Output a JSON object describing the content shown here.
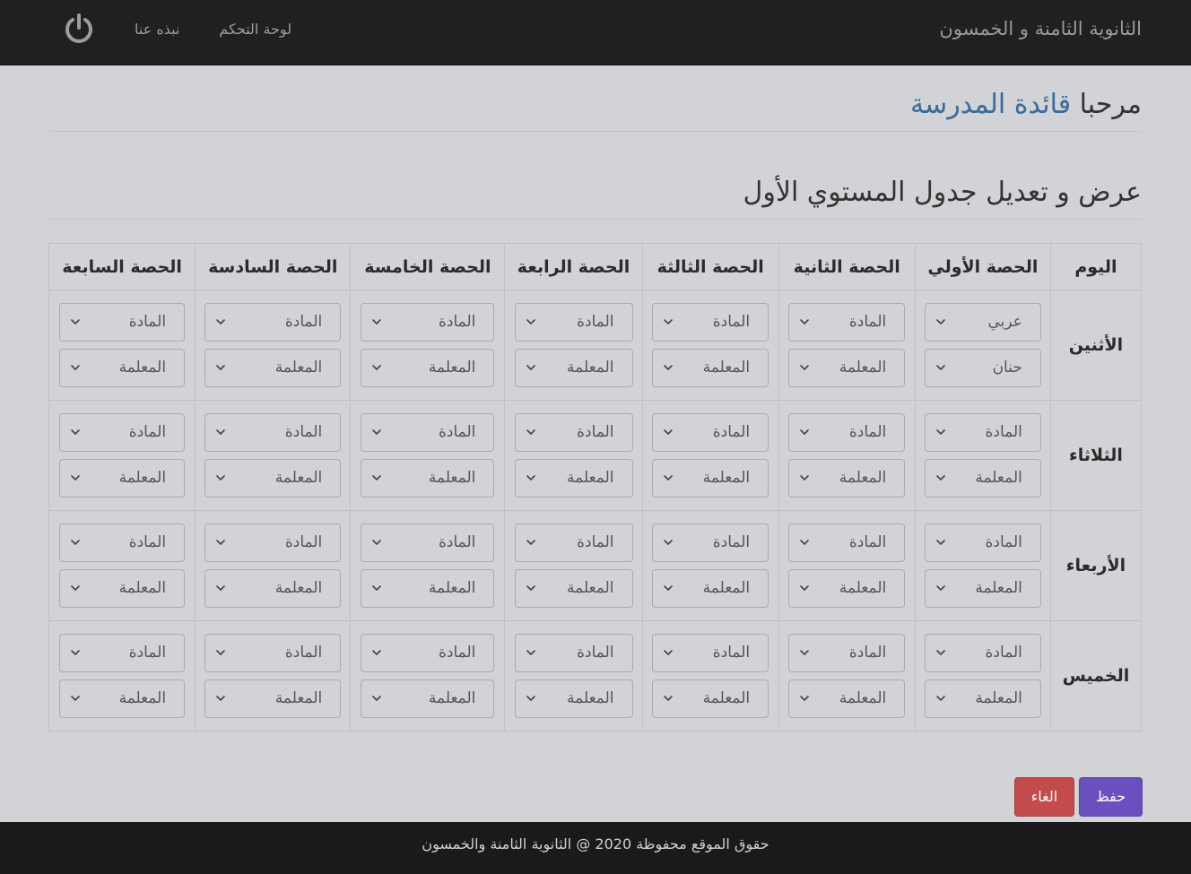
{
  "navbar": {
    "brand": "الثانوية الثامنة و الخمسون",
    "links": [
      "لوحة التحكم",
      "نبذه عنا"
    ],
    "power_icon": "power-icon"
  },
  "welcome": {
    "greeting": "مرحبا",
    "name": "قائدة المدرسة"
  },
  "page_heading": "عرض و تعديل جدول المستوي الأول",
  "schedule": {
    "headers": [
      "اليوم",
      "الحصة الأولي",
      "الحصة الثانية",
      "الحصة الثالثة",
      "الحصة الرابعة",
      "الحصة الخامسة",
      "الحصة السادسة",
      "الحصة السابعة"
    ],
    "days": [
      {
        "day": "الأثنين",
        "periods": [
          {
            "subject": "عربي",
            "teacher": "حنان"
          },
          {
            "subject": "المادة",
            "teacher": "المعلمة"
          },
          {
            "subject": "المادة",
            "teacher": "المعلمة"
          },
          {
            "subject": "المادة",
            "teacher": "المعلمة"
          },
          {
            "subject": "المادة",
            "teacher": "المعلمة"
          },
          {
            "subject": "المادة",
            "teacher": "المعلمة"
          },
          {
            "subject": "المادة",
            "teacher": "المعلمة"
          }
        ]
      },
      {
        "day": "الثلاثاء",
        "periods": [
          {
            "subject": "المادة",
            "teacher": "المعلمة"
          },
          {
            "subject": "المادة",
            "teacher": "المعلمة"
          },
          {
            "subject": "المادة",
            "teacher": "المعلمة"
          },
          {
            "subject": "المادة",
            "teacher": "المعلمة"
          },
          {
            "subject": "المادة",
            "teacher": "المعلمة"
          },
          {
            "subject": "المادة",
            "teacher": "المعلمة"
          },
          {
            "subject": "المادة",
            "teacher": "المعلمة"
          }
        ]
      },
      {
        "day": "الأربعاء",
        "periods": [
          {
            "subject": "المادة",
            "teacher": "المعلمة"
          },
          {
            "subject": "المادة",
            "teacher": "المعلمة"
          },
          {
            "subject": "المادة",
            "teacher": "المعلمة"
          },
          {
            "subject": "المادة",
            "teacher": "المعلمة"
          },
          {
            "subject": "المادة",
            "teacher": "المعلمة"
          },
          {
            "subject": "المادة",
            "teacher": "المعلمة"
          },
          {
            "subject": "المادة",
            "teacher": "المعلمة"
          }
        ]
      },
      {
        "day": "الخميس",
        "periods": [
          {
            "subject": "المادة",
            "teacher": "المعلمة"
          },
          {
            "subject": "المادة",
            "teacher": "المعلمة"
          },
          {
            "subject": "المادة",
            "teacher": "المعلمة"
          },
          {
            "subject": "المادة",
            "teacher": "المعلمة"
          },
          {
            "subject": "المادة",
            "teacher": "المعلمة"
          },
          {
            "subject": "المادة",
            "teacher": "المعلمة"
          },
          {
            "subject": "المادة",
            "teacher": "المعلمة"
          }
        ]
      }
    ]
  },
  "actions": {
    "save_label": "حفظ",
    "cancel_label": "الغاء"
  },
  "footer": {
    "text": "حقوق الموقع محفوظة 2020 @ الثانوية الثامنة والخمسون"
  },
  "colors": {
    "navbar_bg": "#1f2022",
    "page_bg": "#d1d3d6",
    "accent_name": "#3a6b9c",
    "save_button": "#6a4fbf",
    "cancel_button": "#c44b4b",
    "footer_bg": "#1a1a1b"
  }
}
